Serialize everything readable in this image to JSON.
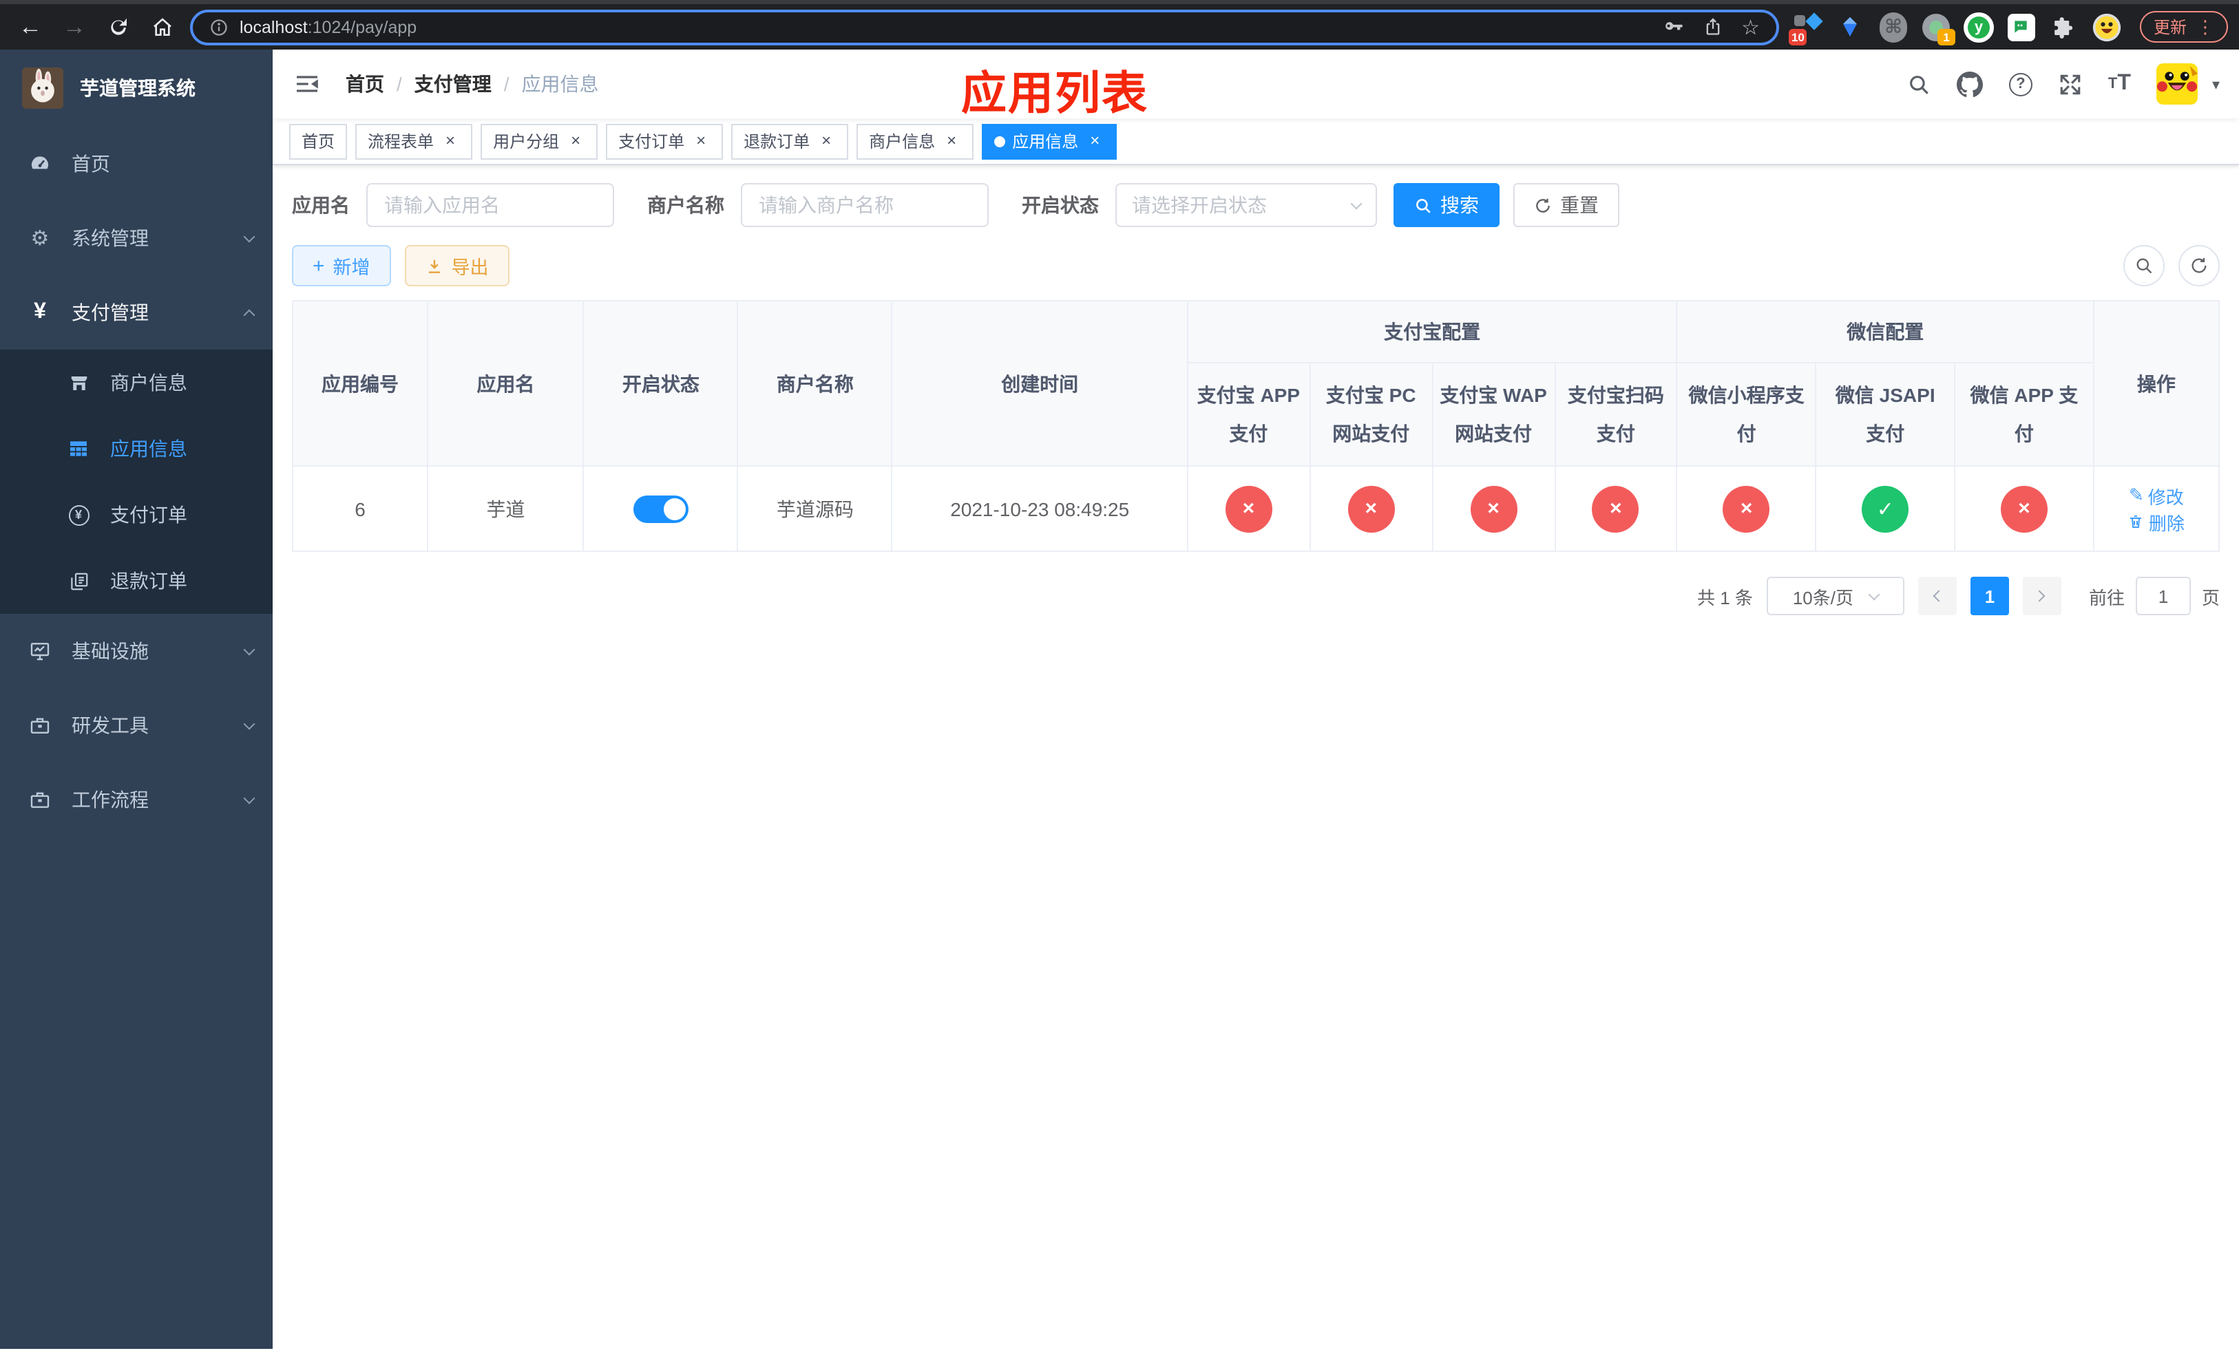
{
  "colors": {
    "primary": "#1890ff",
    "link": "#409eff",
    "success": "#1ec46e",
    "danger": "#f35b5b",
    "warning": "#e6a23c",
    "annotation": "#f4270c",
    "sidebar_bg": "#304156",
    "submenu_bg": "#1f2d3d"
  },
  "icons": {
    "close": "×",
    "plus": "+",
    "edit": "✎",
    "caret": "▾",
    "dots": "⋮",
    "star": "☆",
    "gear": "⚙",
    "yen": "¥",
    "question": "?",
    "check": "✓",
    "cross": "×",
    "font": "T",
    "back": "←",
    "forward": "→",
    "sep": "/"
  },
  "browser": {
    "url_host": "localhost",
    "url_path": ":1024/pay/app",
    "update_label": "更新",
    "ext_badge_grid": "10",
    "ext_badge_record": "1",
    "ext_y_label": "y"
  },
  "sidebar": {
    "title": "芋道管理系统",
    "items": [
      {
        "label": "首页",
        "icon": "dashboard-icon"
      },
      {
        "label": "系统管理",
        "icon": "gear-icon"
      },
      {
        "label": "支付管理",
        "icon": "yen-icon"
      },
      {
        "label": "商户信息",
        "icon": "storefront-icon"
      },
      {
        "label": "应用信息",
        "icon": "grid-icon"
      },
      {
        "label": "支付订单",
        "icon": "yen-circle-icon"
      },
      {
        "label": "退款订单",
        "icon": "documents-icon"
      },
      {
        "label": "基础设施",
        "icon": "monitor-icon"
      },
      {
        "label": "研发工具",
        "icon": "toolbox-icon"
      },
      {
        "label": "工作流程",
        "icon": "toolbox-icon"
      }
    ]
  },
  "header": {
    "breadcrumb": [
      "首页",
      "支付管理",
      "应用信息"
    ],
    "annotation": "应用列表"
  },
  "tabs": [
    {
      "label": "首页",
      "closable": false,
      "active": false
    },
    {
      "label": "流程表单",
      "closable": true,
      "active": false
    },
    {
      "label": "用户分组",
      "closable": true,
      "active": false
    },
    {
      "label": "支付订单",
      "closable": true,
      "active": false
    },
    {
      "label": "退款订单",
      "closable": true,
      "active": false
    },
    {
      "label": "商户信息",
      "closable": true,
      "active": false
    },
    {
      "label": "应用信息",
      "closable": true,
      "active": true
    }
  ],
  "filters": {
    "app_name_label": "应用名",
    "app_name_placeholder": "请输入应用名",
    "merchant_label": "商户名称",
    "merchant_placeholder": "请输入商户名称",
    "status_label": "开启状态",
    "status_placeholder": "请选择开启状态",
    "search_label": "搜索",
    "reset_label": "重置"
  },
  "toolbar": {
    "add_label": "新增",
    "export_label": "导出"
  },
  "table": {
    "groups": {
      "alipay": "支付宝配置",
      "wechat": "微信配置"
    },
    "columns": {
      "id": "应用编号",
      "name": "应用名",
      "status": "开启状态",
      "merchant": "商户名称",
      "created": "创建时间",
      "alipay_app": "支付宝 APP 支付",
      "alipay_pc": "支付宝 PC 网站支付",
      "alipay_wap": "支付宝 WAP 网站支付",
      "alipay_qr": "支付宝扫码支付",
      "wx_mini": "微信小程序支付",
      "wx_jsapi": "微信 JSAPI 支付",
      "wx_app": "微信 APP 支付",
      "actions": "操作"
    },
    "row": {
      "id": "6",
      "name": "芋道",
      "enabled": true,
      "merchant": "芋道源码",
      "created": "2021-10-23 08:49:25",
      "statuses": [
        false,
        false,
        false,
        false,
        false,
        true,
        false
      ],
      "edit_label": "修改",
      "delete_label": "删除"
    }
  },
  "pagination": {
    "total": "共 1 条",
    "page_size": "10条/页",
    "current_page": "1",
    "goto_label": "前往",
    "goto_value": "1",
    "page_unit": "页"
  }
}
